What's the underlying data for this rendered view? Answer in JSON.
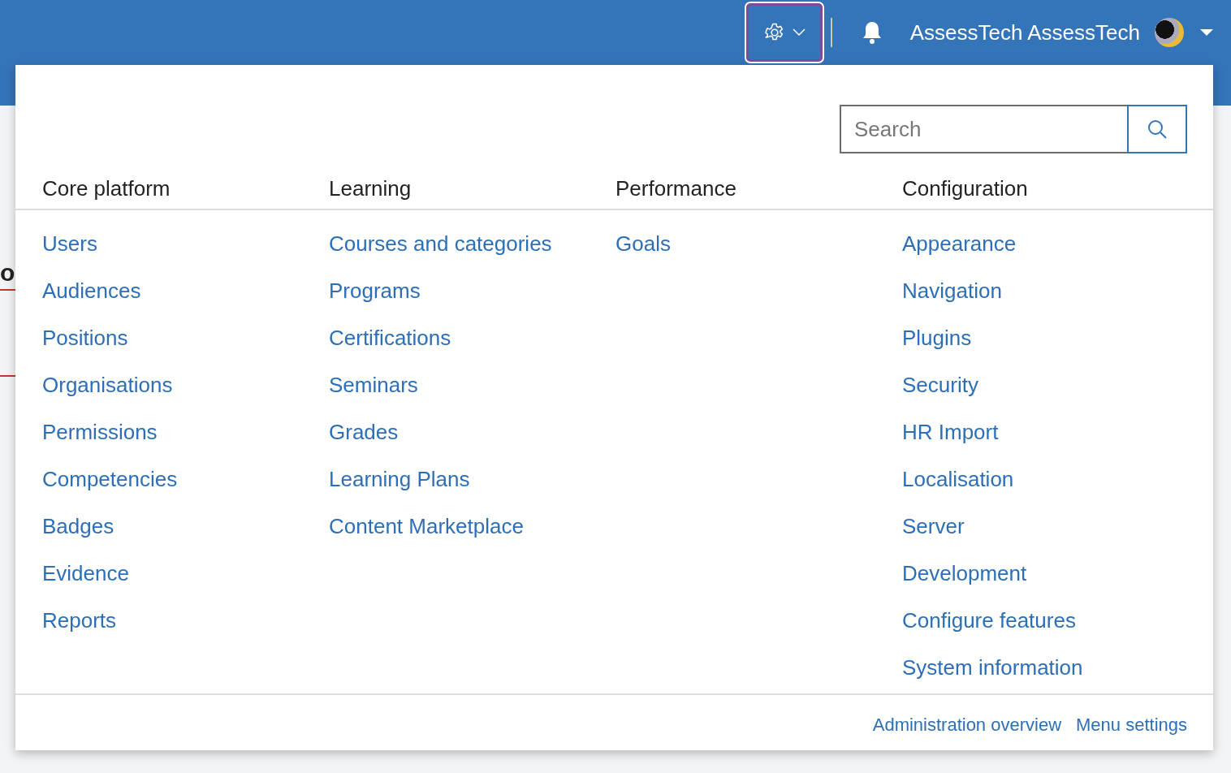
{
  "topbar": {
    "settings_menu_expanded": true,
    "user_name": "AssessTech AssessTech"
  },
  "background": {
    "heading_fragment": "o"
  },
  "menu": {
    "search": {
      "placeholder": "Search"
    },
    "columns": [
      {
        "heading": "Core platform",
        "items": [
          "Users",
          "Audiences",
          "Positions",
          "Organisations",
          "Permissions",
          "Competencies",
          "Badges",
          "Evidence",
          "Reports"
        ]
      },
      {
        "heading": "Learning",
        "items": [
          "Courses and categories",
          "Programs",
          "Certifications",
          "Seminars",
          "Grades",
          "Learning Plans",
          "Content Marketplace"
        ]
      },
      {
        "heading": "Performance",
        "items": [
          "Goals"
        ]
      },
      {
        "heading": "Configuration",
        "items": [
          "Appearance",
          "Navigation",
          "Plugins",
          "Security",
          "HR Import",
          "Localisation",
          "Server",
          "Development",
          "Configure features",
          "System information"
        ]
      }
    ],
    "footer_links": [
      "Administration overview",
      "Menu settings"
    ]
  }
}
